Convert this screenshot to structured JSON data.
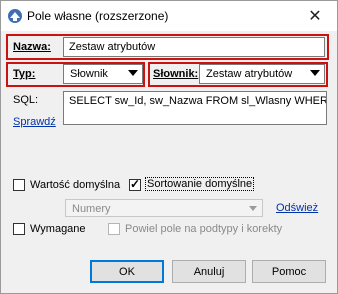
{
  "window": {
    "title": "Pole własne (rozszerzone)",
    "close_glyph": "✕"
  },
  "fields": {
    "nazwa_label": "Nazwa:",
    "nazwa_value": "Zestaw atrybutów",
    "typ_label": "Typ:",
    "typ_value": "Słownik",
    "slownik_label": "Słownik:",
    "slownik_value": "Zestaw atrybutów",
    "sql_label": "SQL:",
    "sql_value": "SELECT sw_Id, sw_Nazwa FROM sl_Wlasny WHERE",
    "sprawdz_label": "Sprawdź"
  },
  "options": {
    "wartosc_domyslna_label": "Wartość domyślna",
    "wartosc_domyslna_checked": false,
    "sortowanie_label": "Sortowanie domyślne",
    "sortowanie_checked": true,
    "numery_value": "Numery",
    "odswiez_label": "Odśwież",
    "wymagane_label": "Wymagane",
    "wymagane_checked": false,
    "powiel_label": "Powiel pole na podtypy i korekty",
    "powiel_checked": false
  },
  "buttons": {
    "ok": "OK",
    "anuluj": "Anuluj",
    "pomoc": "Pomoc"
  },
  "colors": {
    "highlight": "#cc1111",
    "link": "#0033aa",
    "default_button_border": "#0078d7"
  }
}
